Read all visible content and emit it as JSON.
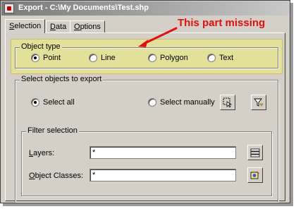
{
  "window": {
    "title": "Export - C:\\My Documents\\Test.shp"
  },
  "tabs": [
    {
      "label": "Selection",
      "underline": "S",
      "rest": "election"
    },
    {
      "label": "Data",
      "underline": "D",
      "rest": "ata"
    },
    {
      "label": "Options",
      "underline": "O",
      "rest": "ptions"
    }
  ],
  "annotation": {
    "text": "This part missing",
    "color": "#e01010",
    "highlight_color": "#e3e09a"
  },
  "object_type": {
    "label": "Object type",
    "options": [
      {
        "label": "Point",
        "selected": true
      },
      {
        "label": "Line",
        "selected": false
      },
      {
        "label": "Polygon",
        "selected": false
      },
      {
        "label": "Text",
        "selected": false
      }
    ]
  },
  "select_objects": {
    "label": "Select objects to export",
    "select_all": "Select all",
    "select_all_selected": true,
    "select_manually": "Select manually",
    "select_manually_selected": false,
    "pick_button_icon": "cursor-select-icon",
    "filter_button_icon": "funnel-filter-icon"
  },
  "filter_selection": {
    "label": "Filter selection",
    "layers_label": "Layers:",
    "layers_value": "*",
    "layers_button_icon": "layers-icon",
    "object_classes_label": "Object Classes:",
    "object_classes_value": "*",
    "object_classes_button_icon": "object-classes-icon"
  }
}
